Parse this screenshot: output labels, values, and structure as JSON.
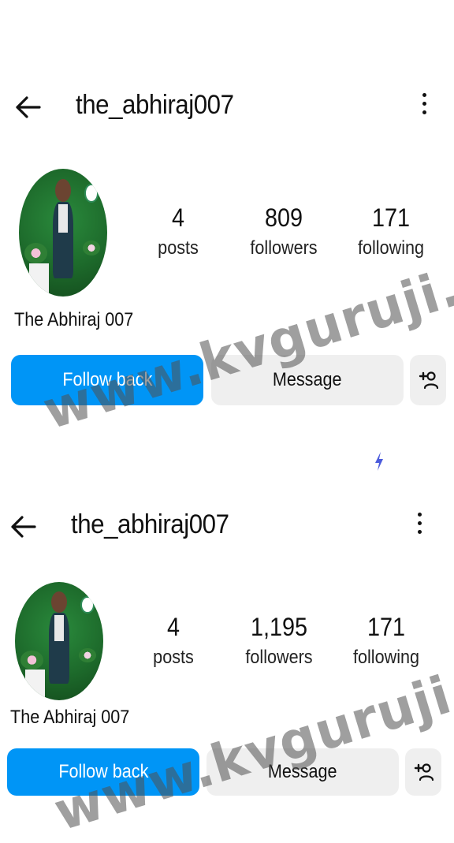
{
  "screens": [
    {
      "username": "the_abhiraj007",
      "display_name": "The Abhiraj 007",
      "stats": {
        "posts": {
          "value": "4",
          "label": "posts"
        },
        "followers": {
          "value": "809",
          "label": "followers"
        },
        "following": {
          "value": "171",
          "label": "following"
        }
      },
      "buttons": {
        "primary": "Follow back",
        "secondary": "Message"
      }
    },
    {
      "username": "the_abhiraj007",
      "display_name": "The Abhiraj 007",
      "stats": {
        "posts": {
          "value": "4",
          "label": "posts"
        },
        "followers": {
          "value": "1,195",
          "label": "followers"
        },
        "following": {
          "value": "171",
          "label": "following"
        }
      },
      "buttons": {
        "primary": "Follow back",
        "secondary": "Message"
      }
    }
  ],
  "watermark": "www.kvguruji.com",
  "icons": [
    "arrow-left-icon",
    "more-vertical-icon",
    "add-person-icon",
    "lightning-icon"
  ],
  "colors": {
    "primary_button": "#0095f6",
    "secondary_button": "#efefef",
    "watermark": "#505050"
  }
}
